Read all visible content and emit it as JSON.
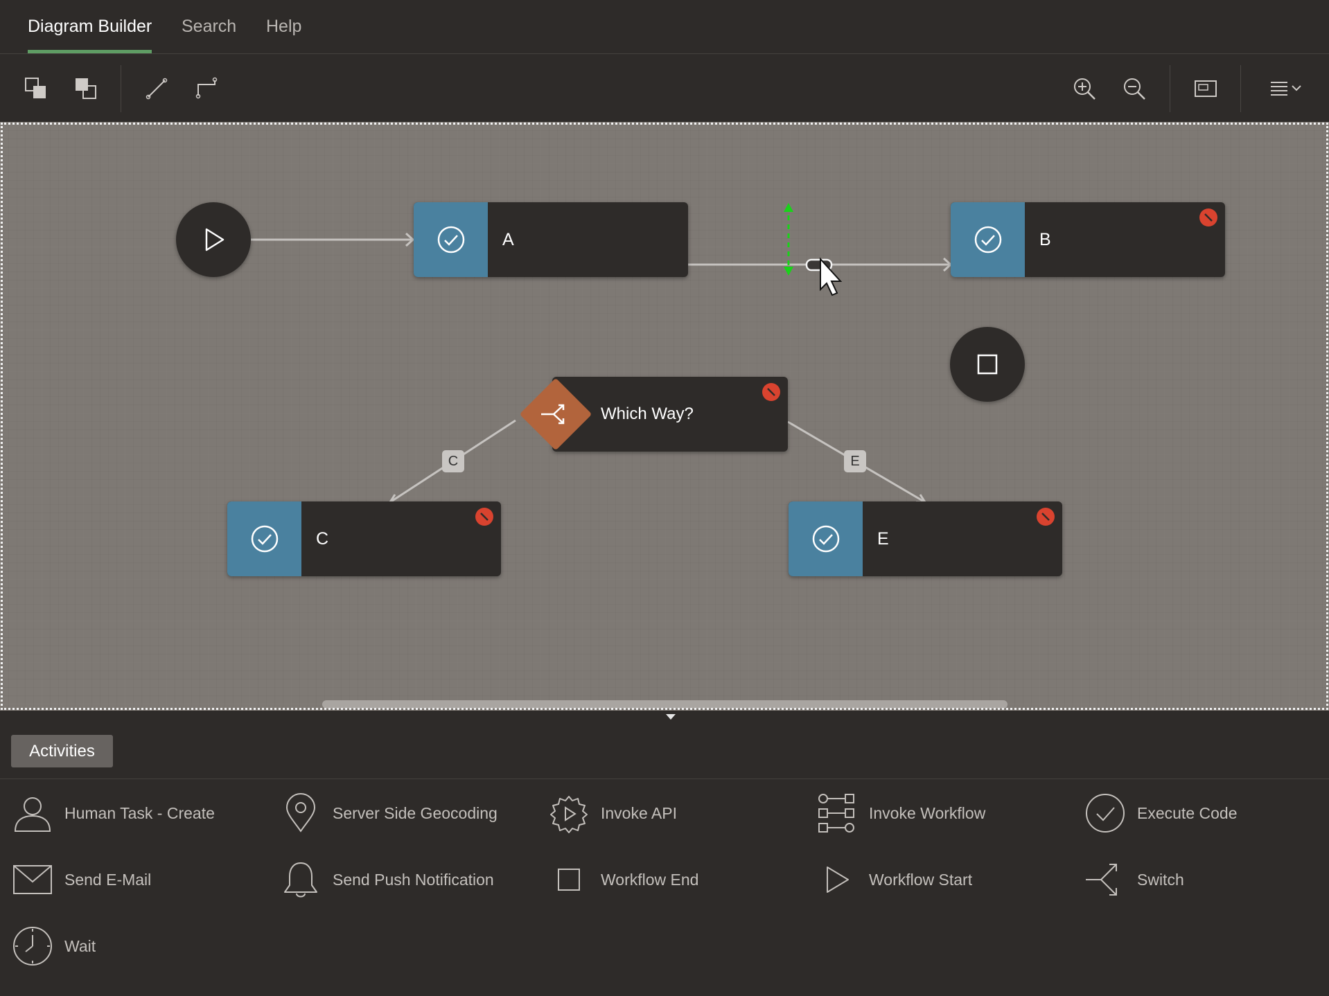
{
  "tabs": [
    {
      "label": "Diagram Builder",
      "active": true
    },
    {
      "label": "Search"
    },
    {
      "label": "Help"
    }
  ],
  "toolbar": {
    "buttons": [
      "bring-to-front-icon",
      "send-to-back-icon",
      "straight-line-icon",
      "orthogonal-line-icon",
      "zoom-in-icon",
      "zoom-out-icon",
      "fit-to-screen-icon",
      "layout-menu-icon"
    ]
  },
  "diagram": {
    "nodes": {
      "start": {
        "type": "Workflow Start",
        "icon": "play-icon"
      },
      "a": {
        "label": "A",
        "icon": "check-circle-icon",
        "error": false
      },
      "b": {
        "label": "B",
        "icon": "check-circle-icon",
        "error": true
      },
      "end": {
        "type": "Workflow End",
        "icon": "stop-square-icon"
      },
      "switch": {
        "label": "Which Way?",
        "icon": "switch-icon",
        "error": true
      },
      "c": {
        "label": "C",
        "icon": "check-circle-icon",
        "error": true
      },
      "e": {
        "label": "E",
        "icon": "check-circle-icon",
        "error": true
      }
    },
    "edges": [
      {
        "from": "start",
        "to": "a"
      },
      {
        "from": "a",
        "to": "b",
        "being_dragged": true
      },
      {
        "from": "switch",
        "to": "c",
        "label": "C"
      },
      {
        "from": "switch",
        "to": "e",
        "label": "E"
      }
    ],
    "colors": {
      "canvas": "#7e7974",
      "node_body": "#2e2b29",
      "task_icon_box": "#4a819f",
      "switch_diamond": "#b2643c",
      "error_badge": "#d9432f",
      "drag_handle": "#19d319",
      "active_tab_underline": "#5f9d64"
    }
  },
  "panel": {
    "tab_label": "Activities",
    "activities": [
      {
        "label": "Human Task - Create",
        "icon": "person-icon"
      },
      {
        "label": "Server Side Geocoding",
        "icon": "map-pin-icon"
      },
      {
        "label": "Invoke API",
        "icon": "gear-play-icon"
      },
      {
        "label": "Invoke Workflow",
        "icon": "workflow-icon"
      },
      {
        "label": "Execute Code",
        "icon": "check-circle-icon"
      },
      {
        "label": "Send E-Mail",
        "icon": "envelope-icon"
      },
      {
        "label": "Send Push Notification",
        "icon": "bell-icon"
      },
      {
        "label": "Workflow End",
        "icon": "square-icon"
      },
      {
        "label": "Workflow Start",
        "icon": "play-icon"
      },
      {
        "label": "Switch",
        "icon": "switch-icon"
      },
      {
        "label": "Wait",
        "icon": "clock-icon"
      }
    ]
  }
}
